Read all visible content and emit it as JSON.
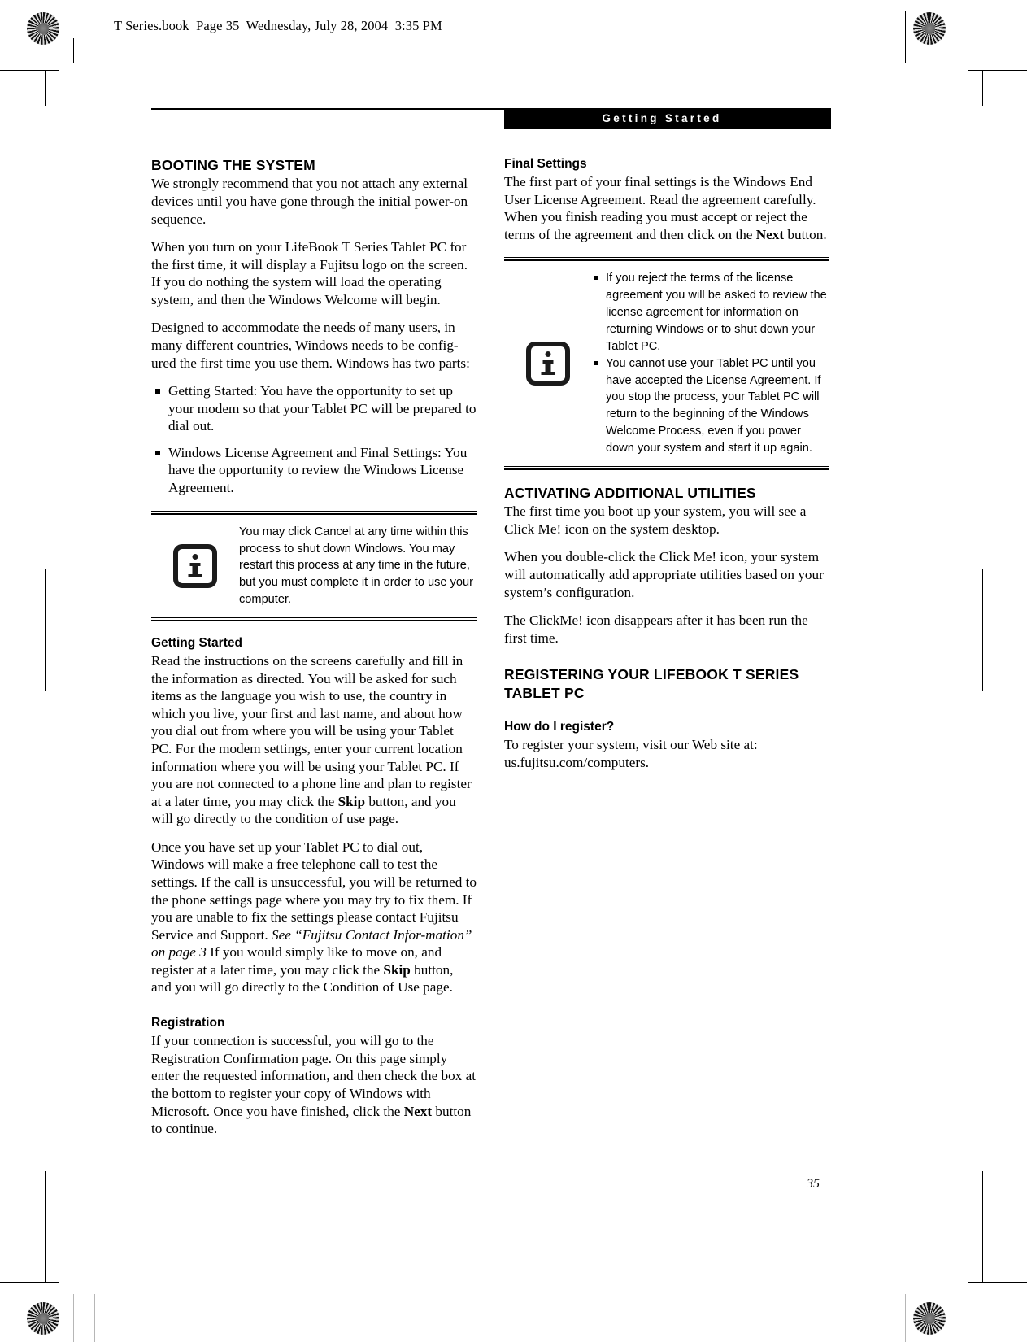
{
  "page": {
    "file_slug": "T Series.book  Page 35  Wednesday, July 28, 2004  3:35 PM",
    "running_head": "Getting Started",
    "folio": "35"
  },
  "left_column": {
    "heading": "BOOTING THE SYSTEM",
    "paragraphs": [
      "We strongly recommend that you not attach any external devices until you have gone through the initial power-on sequence.",
      "When you turn on your LifeBook T Series Tablet PC for the first time, it will display a Fujitsu logo on the screen. If you do nothing the system will load the operating system, and then the Windows Welcome will begin.",
      "Designed to accommodate the needs of many users, in many different countries, Windows needs to be config-ured the first time you use them. Windows has two parts:"
    ],
    "bullets": [
      "Getting Started: You have the opportunity to set up your modem so that your Tablet PC will be prepared to dial out.",
      "Windows License Agreement and Final Settings: You have the opportunity to review the Windows License Agreement."
    ],
    "note": {
      "icon": "info-icon",
      "text": "You may click Cancel at any time within this process to shut down Windows. You may restart this process at any time in the future, but you must complete it in order to use your computer."
    },
    "getting_started": {
      "heading": "Getting Started",
      "para1_a": "Read the instructions on the screens carefully and fill in the information as directed. You will be asked for such items as the language you wish to use, the country in which you live, your first and last name, and about how you dial out from where you will be using your Tablet PC. For the modem settings, enter your current location information where you will be using your Tablet PC. If you are not connected to a phone line and plan to register at a later time, you may click the ",
      "para1_bold": "Skip",
      "para1_b": " button, and you will go directly to the condition of use page.",
      "para2_a": "Once you have set up your Tablet PC to dial out, Windows will make a free telephone call to test the settings. If the call is unsuccessful, you will be returned to the phone settings page where you may try to fix them. If you are unable to fix the settings please contact Fujitsu Service and Support. ",
      "para2_italic": "See “Fujitsu Contact Infor-mation” on page 3",
      "para2_b": " If you would simply like to move on, and register at a later time, you may click the ",
      "para2_bold": "Skip",
      "para2_c": " button, and you will go directly to the Condition of Use page."
    },
    "registration": {
      "heading": "Registration",
      "para_a": "If your connection is successful, you will go to the Registration Confirmation page. On this page simply enter the requested information, and then check the box at the bottom to register your copy of Windows with Microsoft. Once you have finished, click the ",
      "para_bold": "Next",
      "para_b": " button to continue."
    }
  },
  "right_column": {
    "final_settings": {
      "heading": "Final Settings",
      "para_a": "The first part of your final settings is the Windows End User License Agreement. Read the agreement carefully. When you finish reading you must accept or reject the terms of the agreement and then click on the ",
      "para_bold": "Next",
      "para_b": " button."
    },
    "note": {
      "icon": "info-icon",
      "bullets": [
        "If you reject the terms of the license agreement you will be asked to review the license agreement for information on returning Windows or to shut down your Tablet PC.",
        "You cannot use your Tablet PC until you have accepted the License Agreement. If you stop the process, your Tablet PC will return to the beginning of the Windows Welcome Process, even if you power down your system and start it up again."
      ]
    },
    "activating": {
      "heading": "ACTIVATING ADDITIONAL UTILITIES",
      "paragraphs": [
        "The first time you boot up your system, you will see a Click Me! icon on the system desktop.",
        "When you double-click the Click Me! icon, your system will automatically add appropriate utilities based on your system’s configuration.",
        "The ClickMe! icon disappears after it has been run the first time."
      ]
    },
    "registering": {
      "heading": "REGISTERING YOUR LIFEBOOK T SERIES TABLET PC",
      "sub_heading": "How do I register?",
      "paragraph": "To register your system, visit our Web site at: us.fujitsu.com/computers."
    }
  },
  "colors": {
    "ink": "#000000",
    "paper": "#ffffff",
    "bar_background": "#000000",
    "bar_text": "#ffffff"
  }
}
